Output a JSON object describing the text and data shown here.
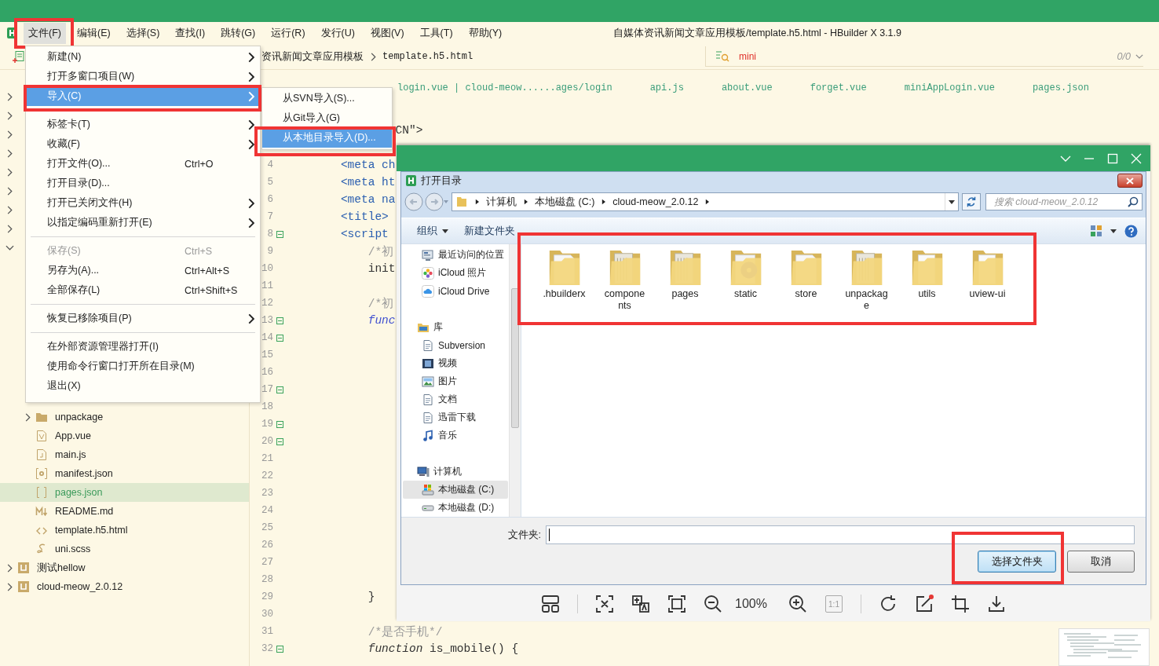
{
  "window": {
    "title": "自媒体资讯新闻文章应用模板/template.h5.html - HBuilder X 3.1.9"
  },
  "menubar": [
    {
      "label": "文件(F)",
      "selected": true,
      "marked": true
    },
    {
      "label": "编辑(E)",
      "selected": false,
      "marked": false
    },
    {
      "label": "选择(S)",
      "selected": false,
      "marked": false
    },
    {
      "label": "查找(I)",
      "selected": false,
      "marked": false
    },
    {
      "label": "跳转(G)",
      "selected": false,
      "marked": false
    },
    {
      "label": "运行(R)",
      "selected": false,
      "marked": false
    },
    {
      "label": "发行(U)",
      "selected": false,
      "marked": false
    },
    {
      "label": "视图(V)",
      "selected": false,
      "marked": false
    },
    {
      "label": "工具(T)",
      "selected": false,
      "marked": false
    },
    {
      "label": "帮助(Y)",
      "selected": false,
      "marked": false
    }
  ],
  "toolbar": {
    "breadcrumb": [
      "资讯新闻文章应用模板",
      "template.h5.html"
    ],
    "search": {
      "value": "mini",
      "count": "0/0"
    }
  },
  "sidebar": {
    "items": [
      {
        "kind": "project",
        "expanded": false
      },
      {
        "kind": "project",
        "expanded": false
      },
      {
        "kind": "project",
        "expanded": false
      },
      {
        "kind": "project",
        "expanded": false
      },
      {
        "kind": "project",
        "expanded": false
      },
      {
        "kind": "project",
        "expanded": false
      },
      {
        "kind": "project",
        "expanded": false
      },
      {
        "kind": "project",
        "expanded": false
      },
      {
        "kind": "project",
        "expanded": true,
        "children": [
          {
            "kind": "row"
          },
          {
            "kind": "row"
          },
          {
            "kind": "row"
          },
          {
            "kind": "row"
          },
          {
            "kind": "row"
          },
          {
            "kind": "row"
          },
          {
            "kind": "row"
          },
          {
            "kind": "row"
          },
          {
            "kind": "folder",
            "label": "unpackage",
            "expanded": false,
            "selected": false
          },
          {
            "kind": "vue",
            "label": "App.vue",
            "selected": false
          },
          {
            "kind": "js",
            "label": "main.js",
            "selected": false
          },
          {
            "kind": "manifest",
            "label": "manifest.json",
            "selected": false
          },
          {
            "kind": "json",
            "label": "pages.json",
            "selected": true
          },
          {
            "kind": "markdown",
            "label": "README.md",
            "selected": false
          },
          {
            "kind": "html",
            "label": "template.h5.html",
            "selected": false
          },
          {
            "kind": "scss",
            "label": "uni.scss",
            "selected": false
          }
        ]
      },
      {
        "kind": "project",
        "label": "测试hellow",
        "expanded": false,
        "selected": false
      },
      {
        "kind": "project",
        "label": "cloud-meow_2.0.12",
        "expanded": false,
        "selected": false
      }
    ]
  },
  "editor": {
    "tabs": [
      {
        "label": "login.vue | cloud-meow......ages/login",
        "selected": false
      },
      {
        "label": "api.js",
        "selected": false
      },
      {
        "label": "about.vue",
        "selected": false
      },
      {
        "label": "forget.vue",
        "selected": false
      },
      {
        "label": "miniAppLogin.vue",
        "selected": false
      },
      {
        "label": "pages.json",
        "selected": false
      }
    ],
    "lines": [
      {
        "text": "               CN\">",
        "kind": "plain"
      },
      {
        "number": "4",
        "text": "       <meta ch",
        "kind": "tag",
        "fold": false
      },
      {
        "number": "5",
        "text": "       <meta ht",
        "kind": "tag",
        "fold": false
      },
      {
        "number": "6",
        "text": "       <meta na",
        "kind": "tag",
        "fold": false
      },
      {
        "number": "7",
        "text": "       <title>",
        "kind": "tag",
        "fold": false
      },
      {
        "number": "8",
        "text": "       <script",
        "kind": "tag",
        "fold": true
      },
      {
        "number": "9",
        "text": "           /*初",
        "kind": "comment",
        "fold": false
      },
      {
        "number": "10",
        "text": "           init",
        "kind": "plain",
        "fold": false
      },
      {
        "number": "11",
        "fold": false
      },
      {
        "number": "12",
        "text": "           /*初",
        "kind": "comment",
        "fold": false
      },
      {
        "number": "13",
        "text": "           func",
        "kind": "keyword",
        "fold": true
      },
      {
        "number": "14",
        "fold": true
      },
      {
        "number": "15",
        "fold": false
      },
      {
        "number": "16",
        "fold": false
      },
      {
        "number": "17",
        "fold": true
      },
      {
        "number": "18",
        "fold": false
      },
      {
        "number": "19",
        "fold": true
      },
      {
        "number": "20",
        "fold": true
      },
      {
        "number": "21",
        "fold": false
      },
      {
        "number": "22",
        "fold": false
      },
      {
        "number": "23",
        "fold": false
      },
      {
        "number": "24",
        "fold": false
      },
      {
        "number": "25",
        "fold": false
      },
      {
        "number": "26",
        "fold": false
      },
      {
        "number": "27",
        "fold": false
      },
      {
        "number": "28",
        "fold": false
      },
      {
        "number": "29",
        "text": "           }",
        "kind": "plain",
        "fold": false
      },
      {
        "number": "30",
        "fold": false
      },
      {
        "number": "31",
        "text": "           /*是否手机*/",
        "kind": "comment",
        "fold": false
      },
      {
        "number": "32",
        "text": "           *function* is_mobile() {",
        "kind": "plain",
        "fold": true
      }
    ]
  },
  "file_menu": {
    "items": [
      {
        "kind": "item",
        "label": "新建(N)",
        "submenu": true,
        "selected": false,
        "disabled": false,
        "marked": false
      },
      {
        "kind": "item",
        "label": "打开多窗口项目(W)",
        "submenu": true,
        "selected": false,
        "disabled": false,
        "marked": false
      },
      {
        "kind": "item",
        "label": "导入(C)",
        "submenu": true,
        "selected": true,
        "disabled": false,
        "marked": true
      },
      {
        "kind": "separator"
      },
      {
        "kind": "item",
        "label": "标签卡(T)",
        "submenu": true,
        "selected": false,
        "disabled": false,
        "marked": false
      },
      {
        "kind": "item",
        "label": "收藏(F)",
        "submenu": true,
        "selected": false,
        "disabled": false,
        "marked": false
      },
      {
        "kind": "item",
        "label": "打开文件(O)...",
        "shortcut": "Ctrl+O",
        "submenu": false,
        "selected": false,
        "disabled": false,
        "marked": false
      },
      {
        "kind": "item",
        "label": "打开目录(D)...",
        "submenu": false,
        "selected": false,
        "disabled": false,
        "marked": false
      },
      {
        "kind": "item",
        "label": "打开已关闭文件(H)",
        "submenu": true,
        "selected": false,
        "disabled": false,
        "marked": false
      },
      {
        "kind": "item",
        "label": "以指定编码重新打开(E)",
        "submenu": true,
        "selected": false,
        "disabled": false,
        "marked": false
      },
      {
        "kind": "separator"
      },
      {
        "kind": "item",
        "label": "保存(S)",
        "shortcut": "Ctrl+S",
        "submenu": false,
        "selected": false,
        "disabled": true,
        "marked": false
      },
      {
        "kind": "item",
        "label": "另存为(A)...",
        "shortcut": "Ctrl+Alt+S",
        "submenu": false,
        "selected": false,
        "disabled": false,
        "marked": false
      },
      {
        "kind": "item",
        "label": "全部保存(L)",
        "shortcut": "Ctrl+Shift+S",
        "submenu": false,
        "selected": false,
        "disabled": false,
        "marked": false
      },
      {
        "kind": "separator"
      },
      {
        "kind": "item",
        "label": "恢复已移除项目(P)",
        "submenu": true,
        "selected": false,
        "disabled": false,
        "marked": false
      },
      {
        "kind": "separator"
      },
      {
        "kind": "item",
        "label": "在外部资源管理器打开(I)",
        "submenu": false,
        "selected": false,
        "disabled": false,
        "marked": false
      },
      {
        "kind": "item",
        "label": "使用命令行窗口打开所在目录(M)",
        "submenu": false,
        "selected": false,
        "disabled": false,
        "marked": false
      },
      {
        "kind": "item",
        "label": "退出(X)",
        "submenu": false,
        "selected": false,
        "disabled": false,
        "marked": false
      }
    ]
  },
  "import_submenu": {
    "items": [
      {
        "label": "从SVN导入(S)...",
        "selected": false,
        "marked": false
      },
      {
        "label": "从Git导入(G)",
        "selected": false,
        "marked": false
      },
      {
        "label": "从本地目录导入(D)...",
        "selected": true,
        "marked": true
      }
    ]
  },
  "dialog": {
    "title": "打开目录",
    "path": [
      "计算机",
      "本地磁盘 (C:)",
      "cloud-meow_2.0.12"
    ],
    "search": {
      "placeholder": "搜索 cloud-meow_2.0.12"
    },
    "toolbar": [
      {
        "label": "组织",
        "dropdown": true
      },
      {
        "label": "新建文件夹",
        "dropdown": false
      }
    ],
    "nav": [
      {
        "kind": "recent",
        "label": "最近访问的位置",
        "selected": false
      },
      {
        "kind": "photos",
        "label": "iCloud 照片",
        "selected": false
      },
      {
        "kind": "cloud",
        "label": "iCloud Drive",
        "selected": false
      },
      {
        "kind": "library",
        "label": "库",
        "selected": false
      },
      {
        "kind": "svn",
        "label": "Subversion",
        "selected": false
      },
      {
        "kind": "video",
        "label": "视频",
        "selected": false
      },
      {
        "kind": "picture",
        "label": "图片",
        "selected": false
      },
      {
        "kind": "document",
        "label": "文档",
        "selected": false
      },
      {
        "kind": "download",
        "label": "迅雷下载",
        "selected": false
      },
      {
        "kind": "music",
        "label": "音乐",
        "selected": false
      },
      {
        "kind": "computer",
        "label": "计算机",
        "selected": false
      },
      {
        "kind": "drive-c",
        "label": "本地磁盘 (C:)",
        "selected": true
      },
      {
        "kind": "drive",
        "label": "本地磁盘 (D:)",
        "selected": false
      }
    ],
    "folders_marked": true,
    "folders": [
      {
        "kind": "page",
        "label": ".hbuilderx",
        "selected": false
      },
      {
        "kind": "files",
        "label": "components",
        "selected": false
      },
      {
        "kind": "files",
        "label": "pages",
        "selected": false
      },
      {
        "kind": "disc",
        "label": "static",
        "selected": false
      },
      {
        "kind": "page",
        "label": "store",
        "selected": false
      },
      {
        "kind": "files",
        "label": "unpackage",
        "selected": false
      },
      {
        "kind": "plain",
        "label": "utils",
        "selected": false
      },
      {
        "kind": "plain",
        "label": "uview-ui",
        "selected": false
      }
    ],
    "folder_field": {
      "label": "文件夹:"
    },
    "buttons_marked": true,
    "buttons": [
      {
        "label": "选择文件夹",
        "kind": "default"
      },
      {
        "label": "取消",
        "kind": "normal"
      }
    ]
  },
  "viewer_toolbar": [
    {
      "kind": "layout"
    },
    {
      "kind": "separator"
    },
    {
      "kind": "scan"
    },
    {
      "kind": "translate"
    },
    {
      "kind": "fit"
    },
    {
      "kind": "zoom-out"
    },
    {
      "kind": "zoom",
      "label": "100%"
    },
    {
      "kind": "zoom-in"
    },
    {
      "kind": "actual",
      "label": "1:1",
      "disabled": true
    },
    {
      "kind": "separator"
    },
    {
      "kind": "rotate"
    },
    {
      "kind": "edit"
    },
    {
      "kind": "crop"
    },
    {
      "kind": "download"
    }
  ]
}
